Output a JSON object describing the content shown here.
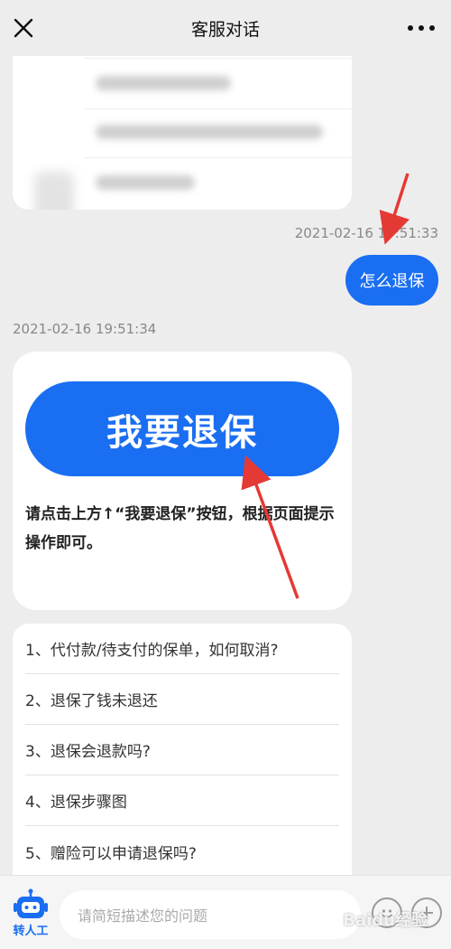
{
  "header": {
    "title": "客服对话"
  },
  "messages": {
    "user_timestamp": "2021-02-16 19:51:33",
    "user_text": "怎么退保",
    "bot_timestamp": "2021-02-16 19:51:34",
    "bot_button_label": "我要退保",
    "bot_text": "请点击上方↑“我要退保”按钮，根据页面提示操作即可。"
  },
  "faq": [
    "1、代付款/待支付的保单，如何取消?",
    "2、退保了钱未退还",
    "3、退保会退款吗?",
    "4、退保步骤图",
    "5、赠险可以申请退保吗?"
  ],
  "bottom": {
    "agent_label": "转人工",
    "input_placeholder": "请简短描述您的问题"
  },
  "watermark": "Baidu经验",
  "colors": {
    "accent": "#1a6ef2",
    "annotation": "#e53935"
  }
}
